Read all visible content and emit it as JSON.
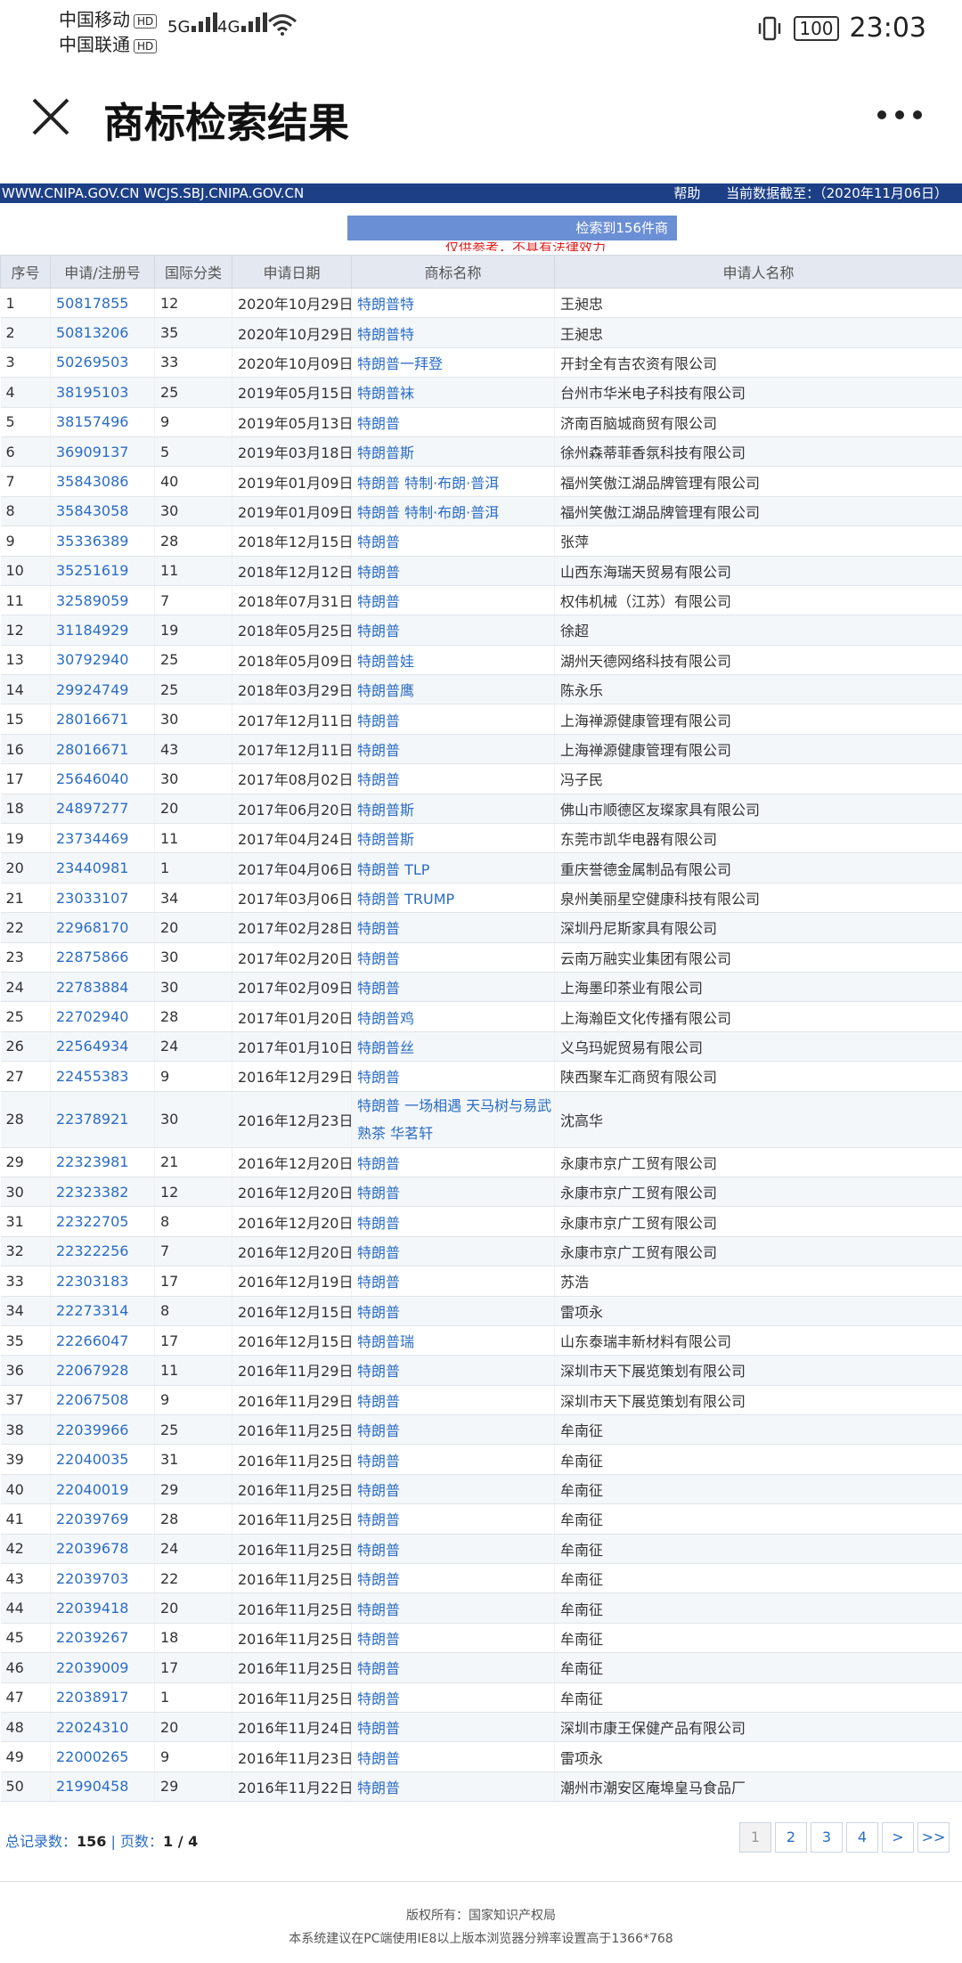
{
  "status": {
    "carrier1": "中国移动",
    "carrier2": "中国联通",
    "hd": "HD",
    "sig1": "5G",
    "sig2": "4G",
    "battery": "100",
    "time": "23:03"
  },
  "app": {
    "title": "商标检索结果"
  },
  "site": {
    "urls": "WWW.CNIPA.GOV.CN WCJS.SBJ.CNIPA.GOV.CN",
    "help": "帮助",
    "data_date": "当前数据截至：（2020年11月06日）"
  },
  "search": {
    "result_text": "检索到156件商",
    "notice": "仅供参考，不具有法律效力"
  },
  "table": {
    "headers": [
      "序号",
      "申请/注册号",
      "国际分类",
      "申请日期",
      "商标名称",
      "申请人名称"
    ],
    "rows": [
      {
        "no": "1",
        "reg": "50817855",
        "cls": "12",
        "date": "2020年10月29日",
        "mark": "特朗普特",
        "applicant": "王昶忠"
      },
      {
        "no": "2",
        "reg": "50813206",
        "cls": "35",
        "date": "2020年10月29日",
        "mark": "特朗普特",
        "applicant": "王昶忠"
      },
      {
        "no": "3",
        "reg": "50269503",
        "cls": "33",
        "date": "2020年10月09日",
        "mark": "特朗普一拜登",
        "applicant": "开封全有吉农资有限公司"
      },
      {
        "no": "4",
        "reg": "38195103",
        "cls": "25",
        "date": "2019年05月15日",
        "mark": "特朗普袜",
        "applicant": "台州市华米电子科技有限公司"
      },
      {
        "no": "5",
        "reg": "38157496",
        "cls": "9",
        "date": "2019年05月13日",
        "mark": "特朗普",
        "applicant": "济南百脑城商贸有限公司"
      },
      {
        "no": "6",
        "reg": "36909137",
        "cls": "5",
        "date": "2019年03月18日",
        "mark": "特朗普斯",
        "applicant": "徐州森蒂菲香氛科技有限公司"
      },
      {
        "no": "7",
        "reg": "35843086",
        "cls": "40",
        "date": "2019年01月09日",
        "mark": "特朗普 特制·布朗·普洱",
        "applicant": "福州笑傲江湖品牌管理有限公司"
      },
      {
        "no": "8",
        "reg": "35843058",
        "cls": "30",
        "date": "2019年01月09日",
        "mark": "特朗普 特制·布朗·普洱",
        "applicant": "福州笑傲江湖品牌管理有限公司"
      },
      {
        "no": "9",
        "reg": "35336389",
        "cls": "28",
        "date": "2018年12月15日",
        "mark": "特朗普",
        "applicant": "张萍"
      },
      {
        "no": "10",
        "reg": "35251619",
        "cls": "11",
        "date": "2018年12月12日",
        "mark": "特朗普",
        "applicant": "山西东海瑞天贸易有限公司"
      },
      {
        "no": "11",
        "reg": "32589059",
        "cls": "7",
        "date": "2018年07月31日",
        "mark": "特朗普",
        "applicant": "权伟机械（江苏）有限公司"
      },
      {
        "no": "12",
        "reg": "31184929",
        "cls": "19",
        "date": "2018年05月25日",
        "mark": "特朗普",
        "applicant": "徐超"
      },
      {
        "no": "13",
        "reg": "30792940",
        "cls": "25",
        "date": "2018年05月09日",
        "mark": "特朗普娃",
        "applicant": "湖州天德网络科技有限公司"
      },
      {
        "no": "14",
        "reg": "29924749",
        "cls": "25",
        "date": "2018年03月29日",
        "mark": "特朗普鹰",
        "applicant": "陈永乐"
      },
      {
        "no": "15",
        "reg": "28016671",
        "cls": "30",
        "date": "2017年12月11日",
        "mark": "特朗普",
        "applicant": "上海禅源健康管理有限公司"
      },
      {
        "no": "16",
        "reg": "28016671",
        "cls": "43",
        "date": "2017年12月11日",
        "mark": "特朗普",
        "applicant": "上海禅源健康管理有限公司"
      },
      {
        "no": "17",
        "reg": "25646040",
        "cls": "30",
        "date": "2017年08月02日",
        "mark": "特朗普",
        "applicant": "冯子民"
      },
      {
        "no": "18",
        "reg": "24897277",
        "cls": "20",
        "date": "2017年06月20日",
        "mark": "特朗普斯",
        "applicant": "佛山市顺德区友璨家具有限公司"
      },
      {
        "no": "19",
        "reg": "23734469",
        "cls": "11",
        "date": "2017年04月24日",
        "mark": "特朗普斯",
        "applicant": "东莞市凯华电器有限公司"
      },
      {
        "no": "20",
        "reg": "23440981",
        "cls": "1",
        "date": "2017年04月06日",
        "mark": "特朗普 TLP",
        "applicant": "重庆誉德金属制品有限公司"
      },
      {
        "no": "21",
        "reg": "23033107",
        "cls": "34",
        "date": "2017年03月06日",
        "mark": "特朗普 TRUMP",
        "applicant": "泉州美丽星空健康科技有限公司"
      },
      {
        "no": "22",
        "reg": "22968170",
        "cls": "20",
        "date": "2017年02月28日",
        "mark": "特朗普",
        "applicant": "深圳丹尼斯家具有限公司"
      },
      {
        "no": "23",
        "reg": "22875866",
        "cls": "30",
        "date": "2017年02月20日",
        "mark": "特朗普",
        "applicant": "云南万融实业集团有限公司"
      },
      {
        "no": "24",
        "reg": "22783884",
        "cls": "30",
        "date": "2017年02月09日",
        "mark": "特朗普",
        "applicant": "上海墨印茶业有限公司"
      },
      {
        "no": "25",
        "reg": "22702940",
        "cls": "28",
        "date": "2017年01月20日",
        "mark": "特朗普鸡",
        "applicant": "上海瀚臣文化传播有限公司"
      },
      {
        "no": "26",
        "reg": "22564934",
        "cls": "24",
        "date": "2017年01月10日",
        "mark": "特朗普丝",
        "applicant": "义乌玛妮贸易有限公司"
      },
      {
        "no": "27",
        "reg": "22455383",
        "cls": "9",
        "date": "2016年12月29日",
        "mark": "特朗普",
        "applicant": "陕西聚车汇商贸有限公司"
      },
      {
        "no": "28",
        "reg": "22378921",
        "cls": "30",
        "date": "2016年12月23日",
        "mark": "特朗普 一场相遇 天马树与易武熟茶 华茗轩",
        "applicant": "沈高华",
        "multi": true
      },
      {
        "no": "29",
        "reg": "22323981",
        "cls": "21",
        "date": "2016年12月20日",
        "mark": "特朗普",
        "applicant": "永康市京广工贸有限公司"
      },
      {
        "no": "30",
        "reg": "22323382",
        "cls": "12",
        "date": "2016年12月20日",
        "mark": "特朗普",
        "applicant": "永康市京广工贸有限公司"
      },
      {
        "no": "31",
        "reg": "22322705",
        "cls": "8",
        "date": "2016年12月20日",
        "mark": "特朗普",
        "applicant": "永康市京广工贸有限公司"
      },
      {
        "no": "32",
        "reg": "22322256",
        "cls": "7",
        "date": "2016年12月20日",
        "mark": "特朗普",
        "applicant": "永康市京广工贸有限公司"
      },
      {
        "no": "33",
        "reg": "22303183",
        "cls": "17",
        "date": "2016年12月19日",
        "mark": "特朗普",
        "applicant": "苏浩"
      },
      {
        "no": "34",
        "reg": "22273314",
        "cls": "8",
        "date": "2016年12月15日",
        "mark": "特朗普",
        "applicant": "雷项永"
      },
      {
        "no": "35",
        "reg": "22266047",
        "cls": "17",
        "date": "2016年12月15日",
        "mark": "特朗普瑞",
        "applicant": "山东泰瑞丰新材料有限公司"
      },
      {
        "no": "36",
        "reg": "22067928",
        "cls": "11",
        "date": "2016年11月29日",
        "mark": "特朗普",
        "applicant": "深圳市天下展览策划有限公司"
      },
      {
        "no": "37",
        "reg": "22067508",
        "cls": "9",
        "date": "2016年11月29日",
        "mark": "特朗普",
        "applicant": "深圳市天下展览策划有限公司"
      },
      {
        "no": "38",
        "reg": "22039966",
        "cls": "25",
        "date": "2016年11月25日",
        "mark": "特朗普",
        "applicant": "牟南征"
      },
      {
        "no": "39",
        "reg": "22040035",
        "cls": "31",
        "date": "2016年11月25日",
        "mark": "特朗普",
        "applicant": "牟南征"
      },
      {
        "no": "40",
        "reg": "22040019",
        "cls": "29",
        "date": "2016年11月25日",
        "mark": "特朗普",
        "applicant": "牟南征"
      },
      {
        "no": "41",
        "reg": "22039769",
        "cls": "28",
        "date": "2016年11月25日",
        "mark": "特朗普",
        "applicant": "牟南征"
      },
      {
        "no": "42",
        "reg": "22039678",
        "cls": "24",
        "date": "2016年11月25日",
        "mark": "特朗普",
        "applicant": "牟南征"
      },
      {
        "no": "43",
        "reg": "22039703",
        "cls": "22",
        "date": "2016年11月25日",
        "mark": "特朗普",
        "applicant": "牟南征"
      },
      {
        "no": "44",
        "reg": "22039418",
        "cls": "20",
        "date": "2016年11月25日",
        "mark": "特朗普",
        "applicant": "牟南征"
      },
      {
        "no": "45",
        "reg": "22039267",
        "cls": "18",
        "date": "2016年11月25日",
        "mark": "特朗普",
        "applicant": "牟南征"
      },
      {
        "no": "46",
        "reg": "22039009",
        "cls": "17",
        "date": "2016年11月25日",
        "mark": "特朗普",
        "applicant": "牟南征"
      },
      {
        "no": "47",
        "reg": "22038917",
        "cls": "1",
        "date": "2016年11月25日",
        "mark": "特朗普",
        "applicant": "牟南征"
      },
      {
        "no": "48",
        "reg": "22024310",
        "cls": "20",
        "date": "2016年11月24日",
        "mark": "特朗普",
        "applicant": "深圳市康王保健产品有限公司"
      },
      {
        "no": "49",
        "reg": "22000265",
        "cls": "9",
        "date": "2016年11月23日",
        "mark": "特朗普",
        "applicant": "雷项永"
      },
      {
        "no": "50",
        "reg": "21990458",
        "cls": "29",
        "date": "2016年11月22日",
        "mark": "特朗普",
        "applicant": "潮州市潮安区庵埠皇马食品厂"
      }
    ]
  },
  "pager": {
    "total_label": "总记录数：",
    "total": "156",
    "sep": " | ",
    "pages_label": "页数：",
    "pages": "1 / 4",
    "buttons": [
      "1",
      "2",
      "3",
      "4",
      ">",
      ">>"
    ]
  },
  "footer": {
    "copyright": "版权所有：国家知识产权局",
    "advice": "本系统建议在PC端使用IE8以上版本浏览器分辨率设置高于1366*768"
  }
}
